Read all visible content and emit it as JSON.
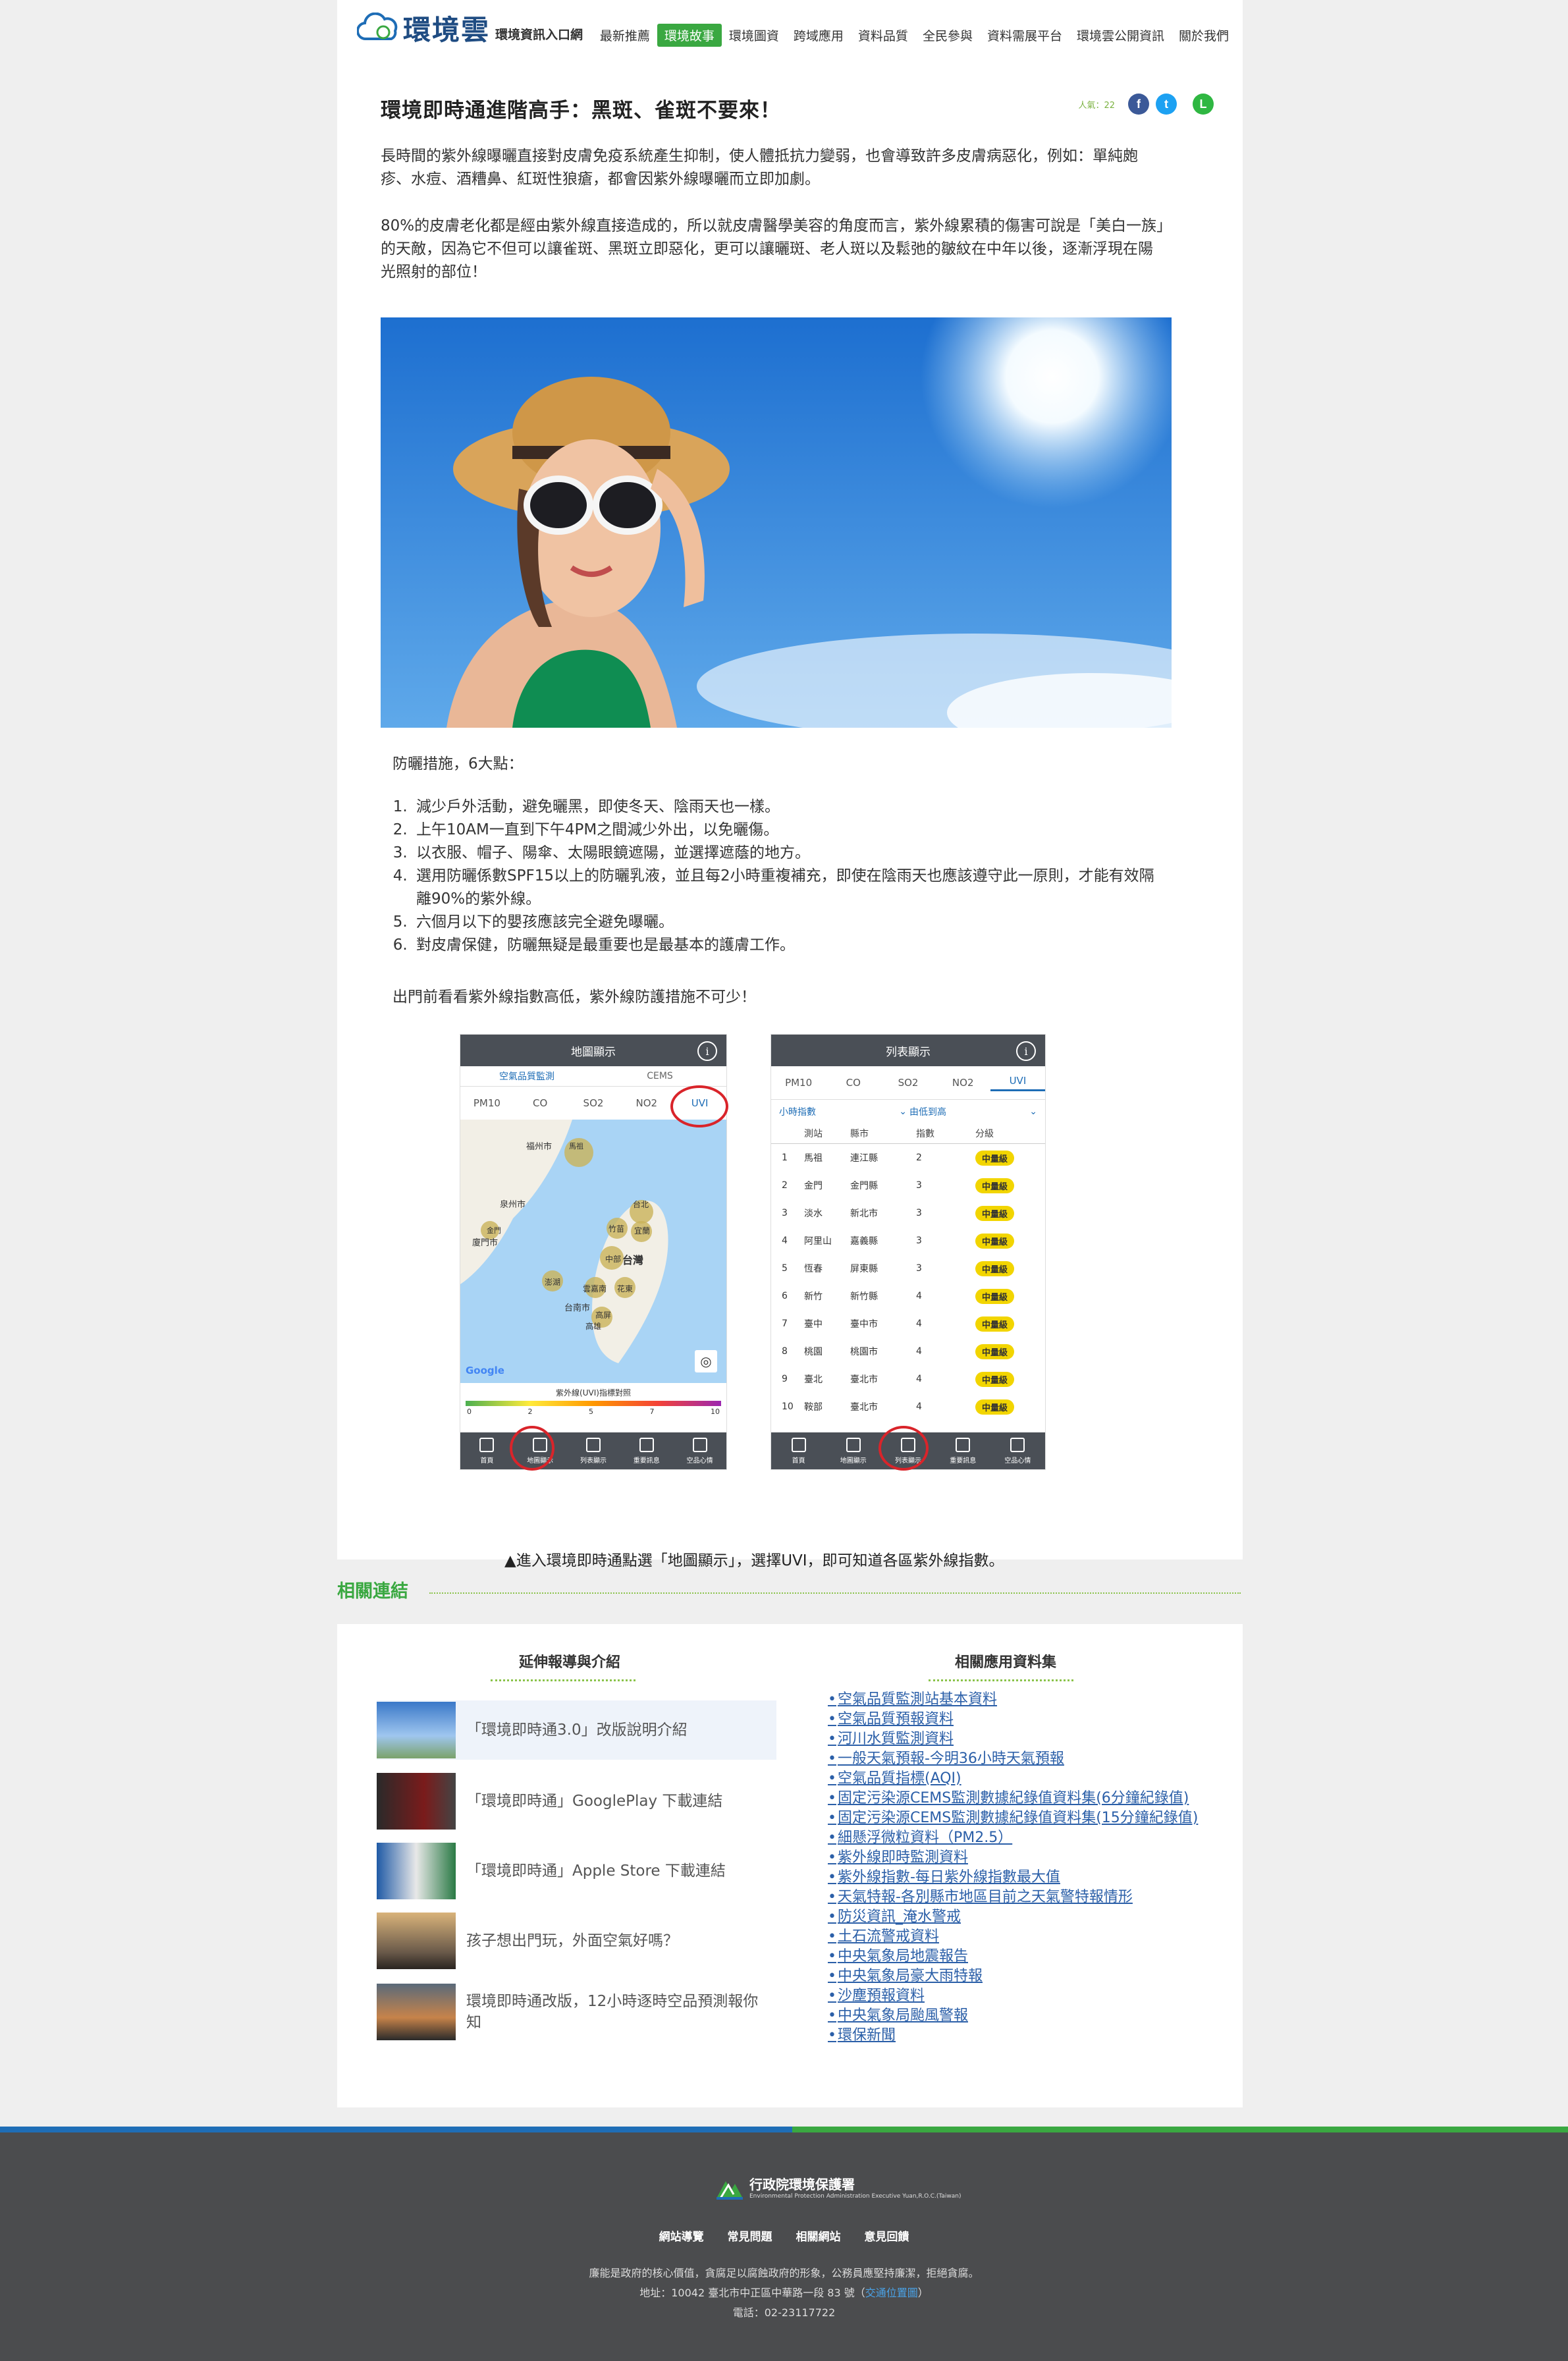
{
  "header": {
    "logo_title": "環境雲",
    "logo_subtitle": "環境資訊入口網",
    "nav": [
      "最新推薦",
      "環境故事",
      "環境圖資",
      "跨域應用",
      "資料品質",
      "全民參與",
      "資料需展平台",
      "環境雲公開資訊",
      "關於我們"
    ]
  },
  "article": {
    "title": "環境即時通進階高手：黑斑、雀斑不要來！",
    "views": "人氣：22",
    "para1": "長時間的紫外線曝曬直接對皮膚免疫系統產生抑制，使人體抵抗力變弱，也會導致許多皮膚病惡化，例如：單純皰疹、水痘、酒糟鼻、紅斑性狼瘡，都會因紫外線曝曬而立即加劇。",
    "para2": "80%的皮膚老化都是經由紫外線直接造成的，所以就皮膚醫學美容的角度而言，紫外線累積的傷害可說是「美白一族」的天敵，因為它不但可以讓雀斑、黑斑立即惡化，更可以讓曬斑、老人斑以及鬆弛的皺紋在中年以後，逐漸浮現在陽光照射的部位！",
    "measures_title": "防曬措施，6大點：",
    "measures": [
      "減少戶外活動，避免曬黑，即使冬天、陰雨天也一樣。",
      "上午10AM一直到下午4PM之間減少外出，以免曬傷。",
      "以衣服、帽子、陽傘、太陽眼鏡遮陽，並選擇遮蔭的地方。",
      "選用防曬係數SPF15以上的防曬乳液，並且每2小時重複補充，即使在陰雨天也應該遵守此一原則，才能有效隔離90%的紫外線。",
      "六個月以下的嬰孩應該完全避免曝曬。",
      "對皮膚保健，防曬無疑是最重要也是最基本的護膚工作。"
    ],
    "outro": "出門前看看紫外線指數高低，紫外線防護措施不可少！",
    "caption": "▲進入環境即時通點選「地圖顯示」，選擇UVI，即可知道各區紫外線指數。"
  },
  "phone_map": {
    "title": "地圖顯示",
    "tab1": "空氣品質監測",
    "tab2": "CEMS",
    "pollutants": [
      "PM10",
      "CO",
      "SO2",
      "NO2",
      "UVI"
    ],
    "places": [
      "福州市",
      "馬祖",
      "泉州市",
      "金門",
      "廈門市",
      "台北",
      "竹苗",
      "宜蘭",
      "中部",
      "台灣",
      "澎湖",
      "雲嘉南",
      "花東",
      "台南市",
      "高屏",
      "高雄"
    ],
    "legend_title": "紫外線(UVI)指標對照",
    "legend_ticks": [
      "0",
      "2",
      "5",
      "7",
      "10"
    ],
    "google": "Google",
    "tabs": [
      "首頁",
      "地圖顯示",
      "列表顯示",
      "重要訊息",
      "空品心情"
    ]
  },
  "phone_list": {
    "title": "列表顯示",
    "pollutants": [
      "PM10",
      "CO",
      "SO2",
      "NO2",
      "UVI"
    ],
    "filter1": "小時指數",
    "filter2": "由低到高",
    "cols": [
      "測站",
      "縣市",
      "指數",
      "分級"
    ],
    "rows": [
      [
        "1",
        "馬祖",
        "連江縣",
        "2",
        "中量級"
      ],
      [
        "2",
        "金門",
        "金門縣",
        "3",
        "中量級"
      ],
      [
        "3",
        "淡水",
        "新北市",
        "3",
        "中量級"
      ],
      [
        "4",
        "阿里山",
        "嘉義縣",
        "3",
        "中量級"
      ],
      [
        "5",
        "恆春",
        "屏東縣",
        "3",
        "中量級"
      ],
      [
        "6",
        "新竹",
        "新竹縣",
        "4",
        "中量級"
      ],
      [
        "7",
        "臺中",
        "臺中市",
        "4",
        "中量級"
      ],
      [
        "8",
        "桃園",
        "桃園市",
        "4",
        "中量級"
      ],
      [
        "9",
        "臺北",
        "臺北市",
        "4",
        "中量級"
      ],
      [
        "10",
        "鞍部",
        "臺北市",
        "4",
        "中量級"
      ]
    ],
    "tabs": [
      "首頁",
      "地圖顯示",
      "列表顯示",
      "重要訊息",
      "空品心情"
    ]
  },
  "related": {
    "heading": "相關連結",
    "col1": "延伸報導與介紹",
    "col2": "相關應用資料集",
    "stories": [
      "「環境即時通3.0」改版說明介紹",
      "「環境即時通」GooglePlay 下載連結",
      "「環境即時通」Apple Store 下載連結",
      "孩子想出門玩，外面空氣好嗎？",
      "環境即時通改版，12小時逐時空品預測報你知"
    ],
    "datasets": [
      "空氣品質監測站基本資料",
      "空氣品質預報資料",
      "河川水質監測資料",
      "一般天氣預報-今明36小時天氣預報",
      "空氣品質指標(AQI)",
      "固定污染源CEMS監測數據紀錄值資料集(6分鐘紀錄值)",
      "固定污染源CEMS監測數據紀錄值資料集(15分鐘紀錄值)",
      "細懸浮微粒資料（PM2.5）",
      "紫外線即時監測資料",
      "紫外線指數-每日紫外線指數最大值",
      "天氣特報-各別縣市地區目前之天氣警特報情形",
      "防災資訊_淹水警戒",
      "土石流警戒資料",
      "中央氣象局地震報告",
      "中央氣象局豪大雨特報",
      "沙塵預報資料",
      "中央氣象局颱風警報",
      "環保新聞"
    ]
  },
  "footer": {
    "org": "行政院環境保護署",
    "org_en": "Environmental Protection Administration Executive Yuan,R.O.C.(Taiwan)",
    "nav": [
      "網站導覽",
      "常見問題",
      "相關網站",
      "意見回饋"
    ],
    "slogan": "廉能是政府的核心價值，貪腐足以腐蝕政府的形象，公務員應堅持廉潔，拒絕貪腐。",
    "address": "地址：10042 臺北市中正區中華路一段 83 號（",
    "address_link": "交通位置圖",
    "address_end": "）",
    "phone": "電話：02-23117722"
  }
}
